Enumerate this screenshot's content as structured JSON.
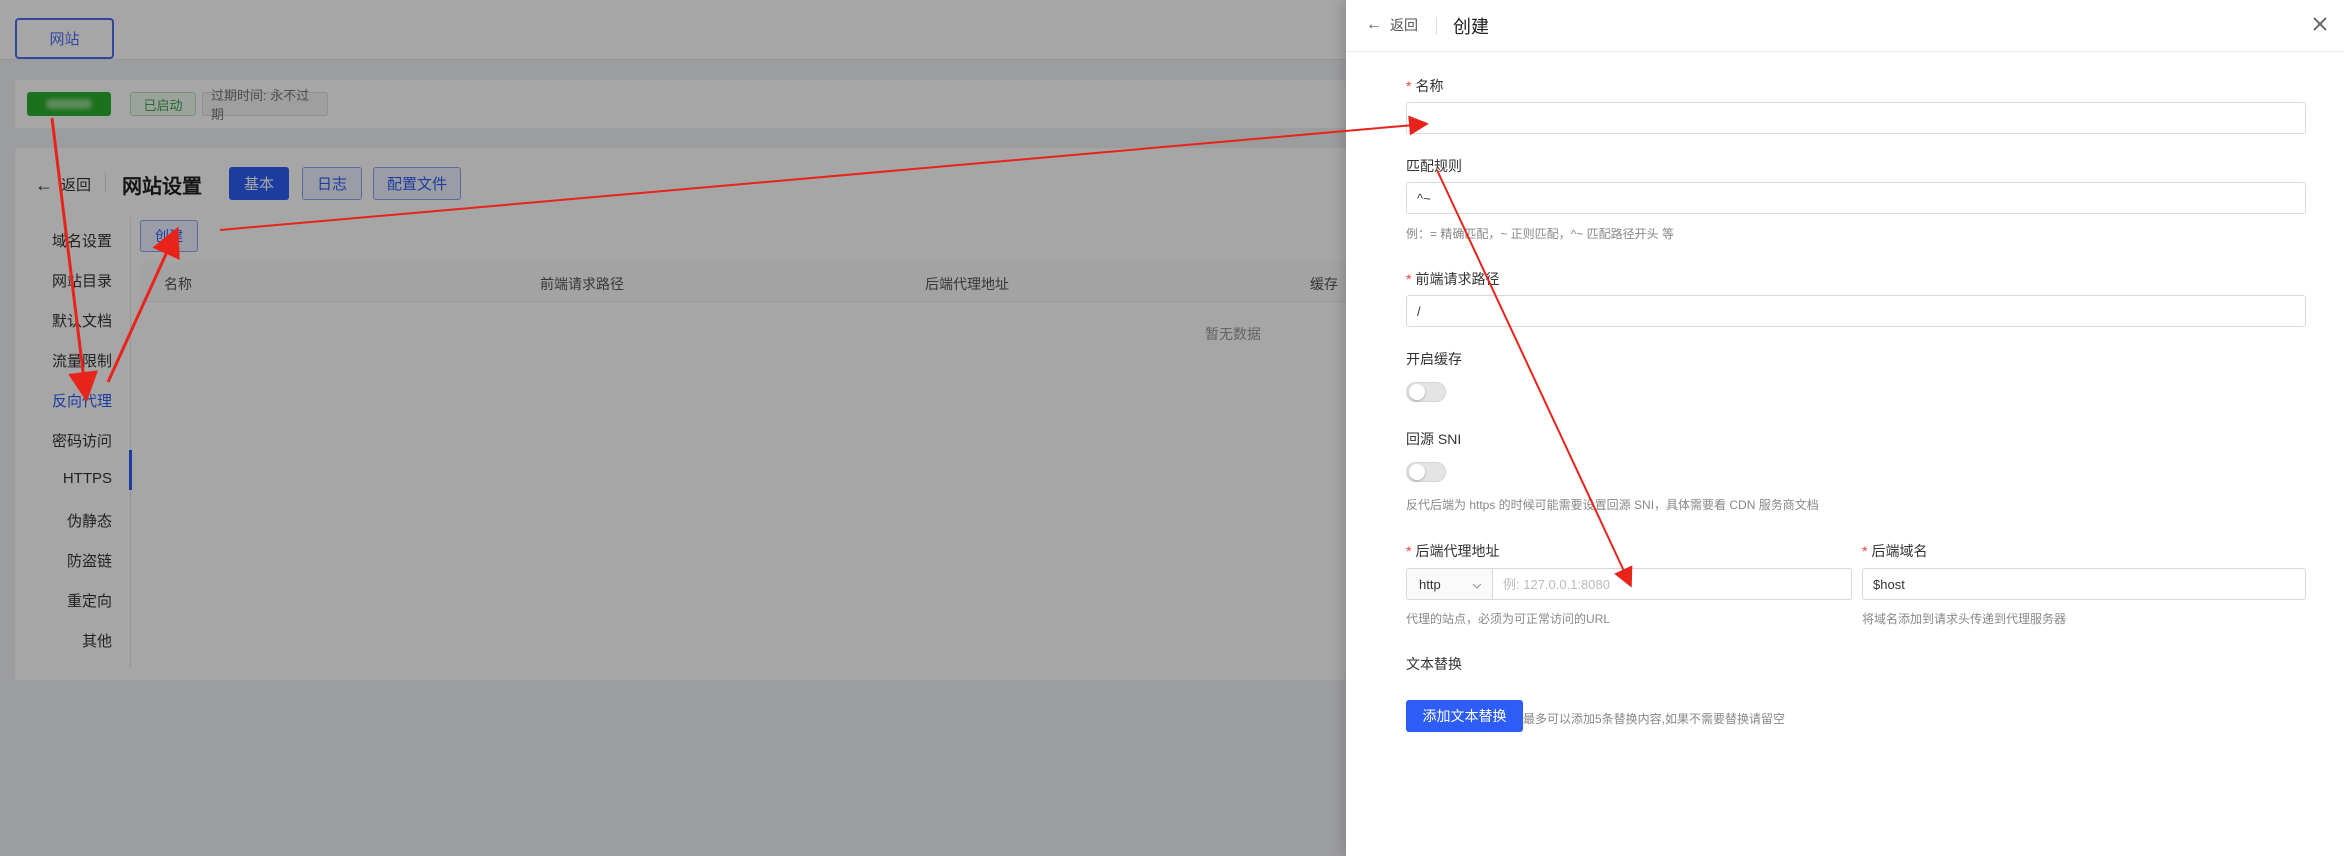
{
  "background": {
    "site_tab": "网站",
    "badges": {
      "running": "已启动",
      "expire": "过期时间: 永不过期"
    },
    "card": {
      "back_label": "返回",
      "title": "网站设置",
      "buttons": {
        "basic": "基本",
        "log": "日志",
        "config_file": "配置文件"
      },
      "menu": [
        "域名设置",
        "网站目录",
        "默认文档",
        "流量限制",
        "反向代理",
        "密码访问",
        "HTTPS",
        "伪静态",
        "防盗链",
        "重定向",
        "其他"
      ],
      "active_menu": "反向代理",
      "create_label": "创建",
      "table_headers": [
        "名称",
        "前端请求路径",
        "后端代理地址",
        "缓存"
      ],
      "empty_text": "暂无数据"
    }
  },
  "drawer": {
    "back_label": "返回",
    "title": "创建",
    "fields": {
      "name": {
        "label": "名称",
        "value": ""
      },
      "match": {
        "label": "匹配规则",
        "value": "^~",
        "help": "例：= 精确匹配，~ 正则匹配，^~ 匹配路径开头 等"
      },
      "frontend_path": {
        "label": "前端请求路径",
        "value": "/"
      },
      "cache": {
        "label": "开启缓存"
      },
      "sni": {
        "label": "回源 SNI",
        "help": "反代后端为 https 的时候可能需要设置回源 SNI，具体需要看 CDN 服务商文档"
      },
      "backend": {
        "label": "后端代理地址",
        "protocol": "http",
        "placeholder": "例: 127.0.0.1:8080",
        "help": "代理的站点，必须为可正常访问的URL"
      },
      "backend_host": {
        "label": "后端域名",
        "value": "$host",
        "help": "将域名添加到请求头传递到代理服务器"
      },
      "text_replace": {
        "label": "文本替换",
        "button": "添加文本替换",
        "hint": "最多可以添加5条替换内容,如果不需要替换请留空"
      }
    }
  },
  "colors": {
    "primary": "#2d5cf6",
    "annotation": "#e8231a",
    "required": "#f04134"
  }
}
